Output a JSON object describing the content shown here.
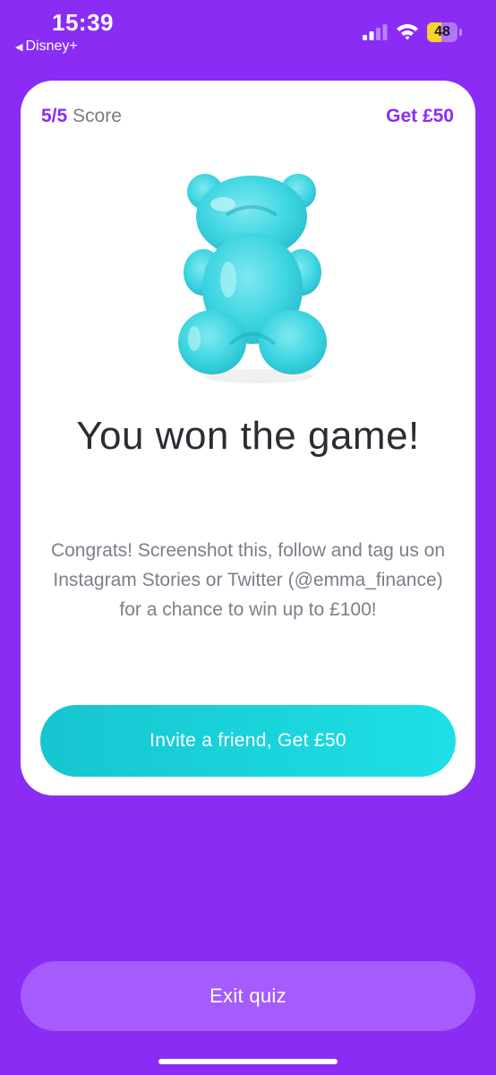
{
  "status_bar": {
    "time": "15:39",
    "back_app": "Disney+",
    "battery_level": "48",
    "battery_fraction": 0.48,
    "icons": [
      "back-triangle-icon",
      "cellular-signal-icon",
      "wifi-icon",
      "battery-icon"
    ]
  },
  "card": {
    "score_value": "5/5",
    "score_label": "Score",
    "get_link": "Get £50",
    "image": "gummy-bear-icon",
    "headline": "You won the game!",
    "body": "Congrats! Screenshot this, follow and tag us on Instagram Stories or Twitter (@emma_finance) for a chance to win up to £100!",
    "cta_label": "Invite a friend, Get £50"
  },
  "exit_label": "Exit quiz",
  "colors": {
    "background": "#8b2cf5",
    "accent": "#8b2cf5",
    "cta": "#1ad2da",
    "exit_button": "#a55cfc",
    "bear": "#3fd6e2",
    "battery": "#f4d32a"
  }
}
